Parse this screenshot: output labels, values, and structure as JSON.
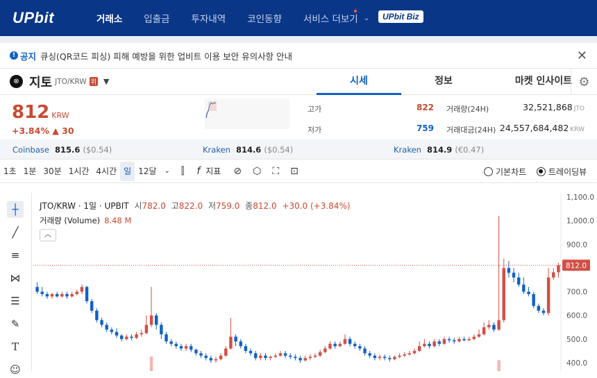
{
  "nav": {
    "logo": "UPbit",
    "items": [
      "거래소",
      "입출금",
      "투자내역",
      "코인동향",
      "서비스 더보기"
    ],
    "biz": "UPbit Biz"
  },
  "notice": {
    "tag": "공지",
    "text": "큐싱(QR코드 피싱) 피해 예방을 위한 업비트 이용 보안 유의사항 안내"
  },
  "coin": {
    "name": "지토",
    "pair": "JTO/KRW",
    "warning": "위"
  },
  "tabs": [
    "시세",
    "정보",
    "마켓 인사이트"
  ],
  "price": {
    "value": "812",
    "unit": "KRW",
    "change_pct": "+3.84%",
    "change_abs": "▲ 30",
    "high_label": "고가",
    "high": "822",
    "low_label": "저가",
    "low": "759",
    "vol_label": "거래량(24H)",
    "vol": "32,521,868",
    "vol_unit": "JTO",
    "amt_label": "거래대금(24H)",
    "amt": "24,557,684,482",
    "amt_unit": "KRW"
  },
  "exchanges": [
    {
      "name": "Coinbase",
      "price": "815.6",
      "diff": "($0.54)"
    },
    {
      "name": "Kraken",
      "price": "814.6",
      "diff": "($0.54)"
    },
    {
      "name": "Kraken",
      "price": "814.9",
      "diff": "(€0.47)"
    }
  ],
  "toolbar": {
    "timeframes": [
      "1초",
      "1분",
      "30분",
      "1시간",
      "4시간",
      "일",
      "12달"
    ],
    "active_tf": "일",
    "indicator": "지표",
    "basic_chart": "기본차트",
    "trading_view": "트레이딩뷰"
  },
  "legend": {
    "title": "JTO/KRW · 1일 · UPBIT",
    "o_label": "시",
    "o": "782.0",
    "h_label": "고",
    "h": "822.0",
    "l_label": "저",
    "l": "759.0",
    "c_label": "종",
    "c": "812.0",
    "chg": "+30.0 (+3.84%)",
    "vol_label": "거래량 (Volume)",
    "vol": "8.48 M"
  },
  "chart_data": {
    "type": "candlestick",
    "y_ticks": [
      "1,100.0",
      "1,000.0",
      "900.0",
      "800.0",
      "700.0",
      "600.0",
      "500.0",
      "400.0"
    ],
    "ylim": [
      395,
      1110
    ],
    "current_price": "812.0",
    "up_color": "#d24f45",
    "down_color": "#1261c4",
    "candles": [
      [
        720,
        700,
        740,
        690
      ],
      [
        700,
        690,
        720,
        680
      ],
      [
        690,
        680,
        700,
        670
      ],
      [
        680,
        690,
        695,
        670
      ],
      [
        690,
        680,
        700,
        675
      ],
      [
        680,
        690,
        700,
        675
      ],
      [
        690,
        680,
        700,
        670
      ],
      [
        680,
        690,
        700,
        675
      ],
      [
        690,
        700,
        710,
        685
      ],
      [
        700,
        720,
        730,
        690
      ],
      [
        720,
        660,
        725,
        650
      ],
      [
        660,
        620,
        670,
        610
      ],
      [
        620,
        580,
        630,
        570
      ],
      [
        580,
        560,
        590,
        550
      ],
      [
        560,
        540,
        570,
        530
      ],
      [
        540,
        530,
        550,
        520
      ],
      [
        530,
        515,
        545,
        505
      ],
      [
        515,
        500,
        520,
        490
      ],
      [
        500,
        510,
        520,
        495
      ],
      [
        510,
        505,
        520,
        495
      ],
      [
        505,
        520,
        530,
        500
      ],
      [
        520,
        525,
        540,
        510
      ],
      [
        525,
        560,
        600,
        520
      ],
      [
        560,
        600,
        720,
        550
      ],
      [
        600,
        560,
        610,
        540
      ],
      [
        560,
        520,
        570,
        500
      ],
      [
        520,
        490,
        530,
        480
      ],
      [
        490,
        480,
        500,
        470
      ],
      [
        480,
        470,
        490,
        460
      ],
      [
        470,
        460,
        480,
        450
      ],
      [
        460,
        470,
        480,
        450
      ],
      [
        470,
        455,
        480,
        445
      ],
      [
        455,
        440,
        460,
        430
      ],
      [
        440,
        430,
        450,
        420
      ],
      [
        430,
        420,
        440,
        410
      ],
      [
        420,
        410,
        430,
        400
      ],
      [
        410,
        415,
        425,
        400
      ],
      [
        415,
        430,
        440,
        410
      ],
      [
        430,
        460,
        470,
        425
      ],
      [
        460,
        510,
        590,
        455
      ],
      [
        510,
        490,
        520,
        470
      ],
      [
        490,
        470,
        500,
        460
      ],
      [
        470,
        450,
        480,
        440
      ],
      [
        450,
        440,
        460,
        430
      ],
      [
        440,
        420,
        450,
        410
      ],
      [
        420,
        430,
        440,
        410
      ],
      [
        430,
        420,
        440,
        410
      ],
      [
        420,
        425,
        430,
        410
      ],
      [
        425,
        430,
        440,
        420
      ],
      [
        430,
        440,
        450,
        425
      ],
      [
        440,
        430,
        450,
        420
      ],
      [
        430,
        425,
        440,
        415
      ],
      [
        425,
        420,
        435,
        410
      ],
      [
        420,
        410,
        430,
        400
      ],
      [
        410,
        420,
        430,
        405
      ],
      [
        420,
        425,
        435,
        410
      ],
      [
        425,
        430,
        440,
        420
      ],
      [
        430,
        445,
        455,
        425
      ],
      [
        445,
        460,
        470,
        440
      ],
      [
        460,
        480,
        490,
        455
      ],
      [
        480,
        470,
        490,
        460
      ],
      [
        470,
        480,
        490,
        465
      ],
      [
        480,
        500,
        520,
        475
      ],
      [
        500,
        480,
        510,
        470
      ],
      [
        480,
        470,
        490,
        460
      ],
      [
        470,
        460,
        480,
        450
      ],
      [
        460,
        440,
        470,
        430
      ],
      [
        440,
        430,
        450,
        420
      ],
      [
        430,
        420,
        440,
        410
      ],
      [
        420,
        425,
        435,
        410
      ],
      [
        425,
        420,
        435,
        410
      ],
      [
        420,
        415,
        430,
        405
      ],
      [
        415,
        425,
        430,
        410
      ],
      [
        425,
        430,
        440,
        420
      ],
      [
        430,
        435,
        445,
        425
      ],
      [
        435,
        440,
        450,
        430
      ],
      [
        440,
        450,
        460,
        435
      ],
      [
        450,
        470,
        490,
        445
      ],
      [
        470,
        480,
        500,
        465
      ],
      [
        480,
        470,
        490,
        460
      ],
      [
        470,
        490,
        500,
        465
      ],
      [
        490,
        480,
        500,
        470
      ],
      [
        480,
        500,
        510,
        475
      ],
      [
        500,
        495,
        510,
        485
      ],
      [
        495,
        490,
        505,
        480
      ],
      [
        490,
        500,
        510,
        485
      ],
      [
        500,
        495,
        510,
        490
      ],
      [
        495,
        500,
        510,
        490
      ],
      [
        500,
        510,
        520,
        495
      ],
      [
        510,
        520,
        540,
        505
      ],
      [
        520,
        550,
        570,
        515
      ],
      [
        550,
        560,
        580,
        540
      ],
      [
        560,
        540,
        570,
        530
      ],
      [
        540,
        580,
        1020,
        535
      ],
      [
        580,
        800,
        840,
        570
      ],
      [
        800,
        780,
        830,
        760
      ],
      [
        780,
        760,
        800,
        740
      ],
      [
        760,
        730,
        780,
        720
      ],
      [
        730,
        700,
        760,
        690
      ],
      [
        700,
        690,
        720,
        680
      ],
      [
        690,
        640,
        700,
        630
      ],
      [
        640,
        620,
        650,
        610
      ],
      [
        620,
        610,
        630,
        600
      ],
      [
        610,
        760,
        800,
        600
      ],
      [
        760,
        782,
        800,
        750
      ],
      [
        782,
        812,
        822,
        759
      ]
    ],
    "volumes": [
      0,
      0,
      0,
      0,
      0,
      0,
      0,
      0,
      0,
      0,
      0,
      0,
      0,
      0,
      0,
      0,
      0,
      0,
      0,
      0,
      0,
      0,
      0,
      0.08,
      0,
      0,
      0,
      0,
      0,
      0,
      0,
      0,
      0,
      0,
      0,
      0,
      0,
      0,
      0,
      0,
      0,
      0,
      0,
      0,
      0,
      0,
      0,
      0,
      0,
      0,
      0,
      0,
      0,
      0,
      0,
      0,
      0,
      0,
      0,
      0,
      0,
      0,
      0,
      0,
      0,
      0,
      0,
      0,
      0,
      0,
      0,
      0,
      0,
      0,
      0,
      0,
      0,
      0,
      0,
      0,
      0,
      0,
      0,
      0,
      0,
      0,
      0,
      0,
      0,
      0,
      0,
      0,
      0,
      0.06,
      0,
      0,
      0,
      0,
      0,
      0,
      0,
      0,
      0,
      0,
      0,
      0
    ]
  }
}
